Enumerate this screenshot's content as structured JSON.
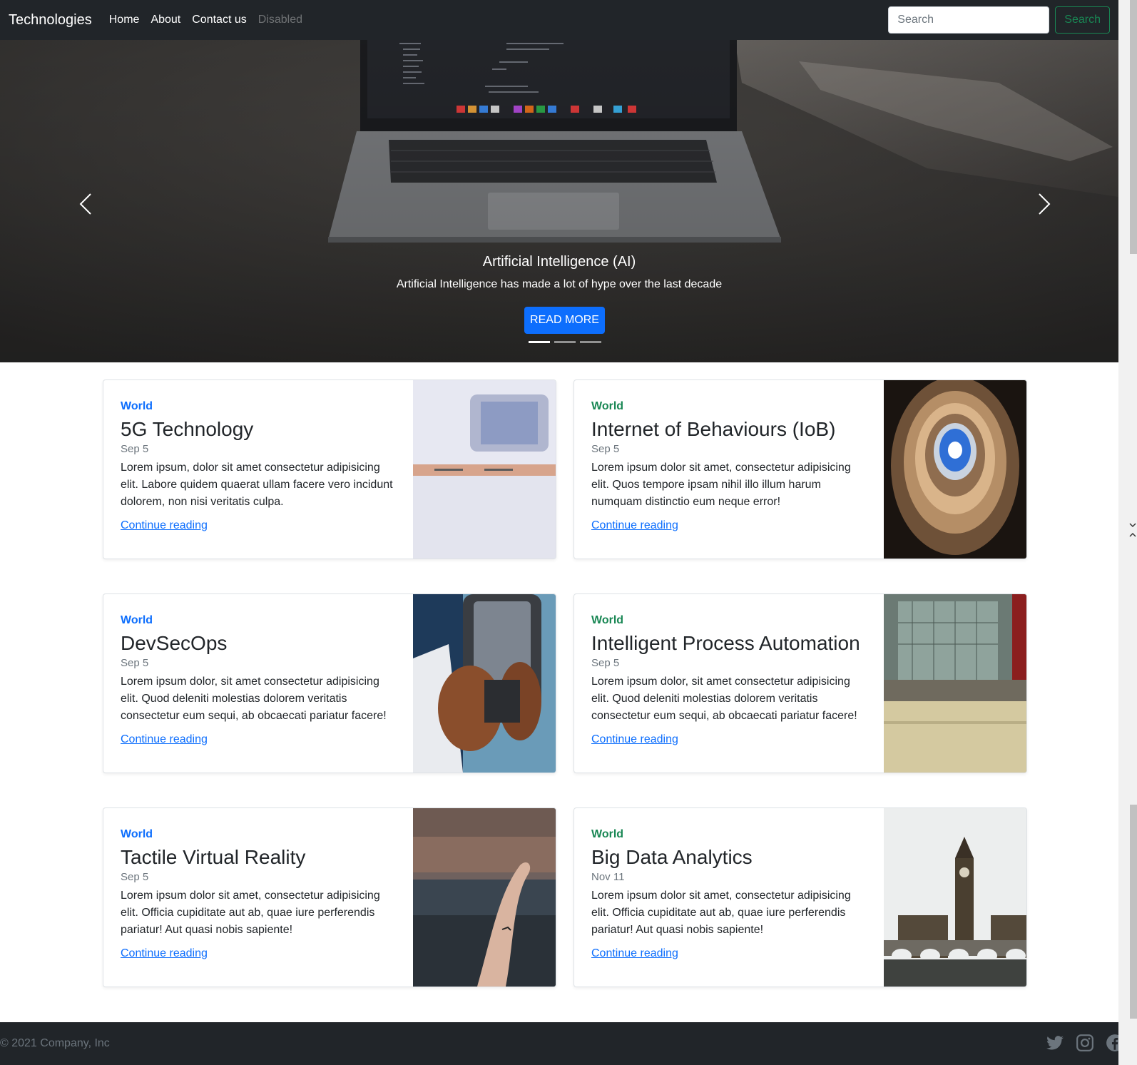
{
  "navbar": {
    "brand": "Technologies",
    "links": [
      "Home",
      "About",
      "Contact us",
      "Disabled"
    ],
    "search_placeholder": "Search",
    "search_button": "Search"
  },
  "hero": {
    "title": "Artificial Intelligence (AI)",
    "text": "Artificial Intelligence has made a lot of hype over the last decade",
    "button": "READ MORE",
    "slides": 3,
    "active_slide": 1
  },
  "cards": [
    {
      "category": "World",
      "title": "5G Technology",
      "date": "Sep 5",
      "text": "Lorem ipsum, dolor sit amet consectetur adipisicing elit. Labore quidem quaerat ullam facere vero incidunt dolorem, non nisi veritatis culpa.",
      "link": "Continue reading"
    },
    {
      "category": "World",
      "title": "Internet of Behaviours (IoB)",
      "date": "Sep 5",
      "text": "Lorem ipsum dolor sit amet, consectetur adipisicing elit. Quos tempore ipsam nihil illo illum harum numquam distinctio eum neque error!",
      "link": "Continue reading"
    },
    {
      "category": "World",
      "title": "DevSecOps",
      "date": "Sep 5",
      "text": "Lorem ipsum dolor, sit amet consectetur adipisicing elit. Quod deleniti molestias dolorem veritatis consectetur eum sequi, ab obcaecati pariatur facere!",
      "link": "Continue reading"
    },
    {
      "category": "World",
      "title": "Intelligent Process Automation",
      "date": "Sep 5",
      "text": "Lorem ipsum dolor, sit amet consectetur adipisicing elit. Quod deleniti molestias dolorem veritatis consectetur eum sequi, ab obcaecati pariatur facere!",
      "link": "Continue reading"
    },
    {
      "category": "World",
      "title": "Tactile Virtual Reality",
      "date": "Sep 5",
      "text": "Lorem ipsum dolor sit amet, consectetur adipisicing elit. Officia cupiditate aut ab, quae iure perferendis pariatur! Aut quasi nobis sapiente!",
      "link": "Continue reading"
    },
    {
      "category": "World",
      "title": "Big Data Analytics",
      "date": "Nov 11",
      "text": "Lorem ipsum dolor sit amet, consectetur adipisicing elit. Officia cupiditate aut ab, quae iure perferendis pariatur! Aut quasi nobis sapiente!",
      "link": "Continue reading"
    }
  ],
  "footer": {
    "copyright": "© 2021 Company, Inc",
    "socials": [
      "twitter-icon",
      "instagram-icon",
      "facebook-icon"
    ]
  },
  "colors": {
    "navbar_bg": "#212529",
    "primary": "#0d6efd",
    "success": "#198754",
    "muted": "#6c757d"
  }
}
